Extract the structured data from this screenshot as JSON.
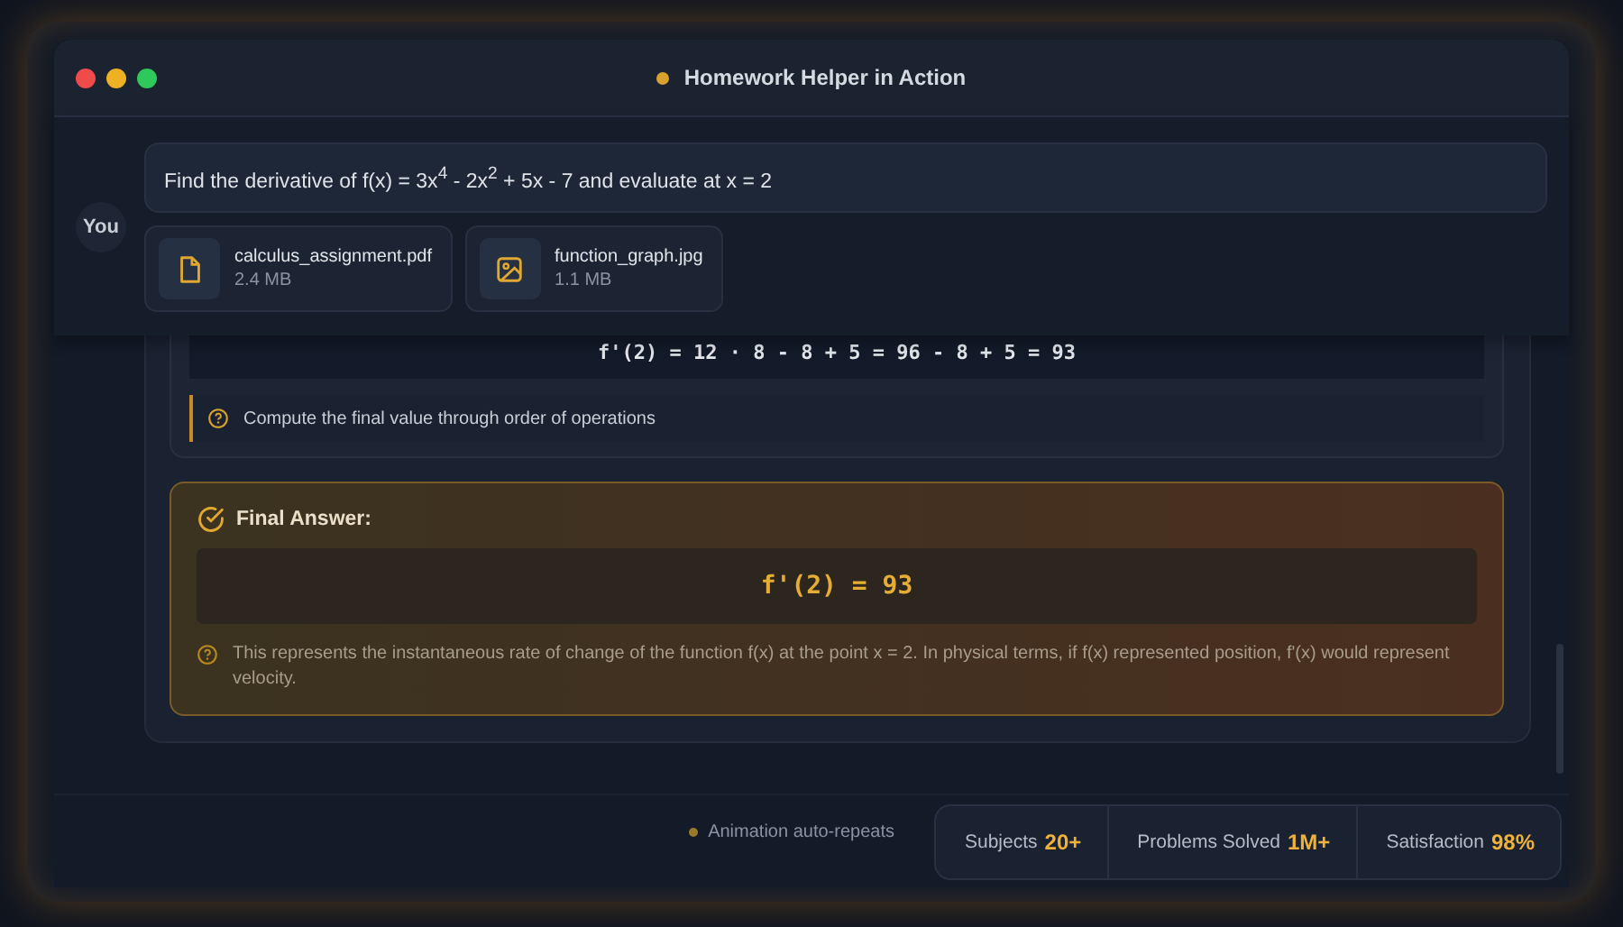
{
  "window": {
    "title": "Homework Helper in Action"
  },
  "user": {
    "label": "You",
    "question": "Find the derivative of f(x) = 3x$^{4}$ - 2x$^{2}$ + 5x - 7 and evaluate at x = 2",
    "attachments": [
      {
        "kind": "document",
        "name": "calculus_assignment.pdf",
        "size": "2.4 MB"
      },
      {
        "kind": "image",
        "name": "function_graph.jpg",
        "size": "1.1 MB"
      }
    ]
  },
  "step": {
    "formula": "f'(2) = 12 · 8 - 8 + 5 = 96 - 8 + 5 = 93",
    "hint": "Compute the final value through order of operations"
  },
  "final": {
    "title": "Final Answer:",
    "answer": "f'(2) = 93",
    "note": "This represents the instantaneous rate of change of the function f(x) at the point x = 2. In physical terms, if f(x) represented position, f'(x) would represent velocity."
  },
  "footer": {
    "note": "Animation auto-repeats",
    "stats": [
      {
        "label": "Subjects",
        "value": "20+"
      },
      {
        "label": "Problems Solved",
        "value": "1M+"
      },
      {
        "label": "Satisfaction",
        "value": "98%"
      }
    ]
  }
}
